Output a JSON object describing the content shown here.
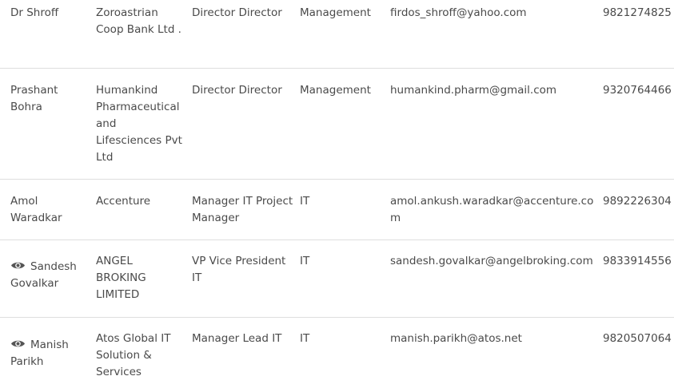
{
  "rows": [
    {
      "name": "Dr Shroff",
      "company": "Zoroastrian Coop Bank Ltd .",
      "title": "Director Director",
      "department": "Management",
      "email": "firdos_shroff@yahoo.com",
      "phone": "9821274825",
      "icon": ""
    },
    {
      "name": "Prashant Bohra",
      "company": "Humankind Pharmaceutical and Lifesciences Pvt Ltd",
      "title": "Director Director",
      "department": "Management",
      "email": "humankind.pharm@gmail.com",
      "phone": "9320764466",
      "icon": ""
    },
    {
      "name": "Amol Waradkar",
      "company": "Accenture",
      "title": "Manager IT Project Manager",
      "department": "IT",
      "email": "amol.ankush.waradkar@accenture.com",
      "phone": "9892226304",
      "icon": ""
    },
    {
      "name": "Sandesh Govalkar",
      "company": "ANGEL BROKING LIMITED",
      "title": "VP Vice President IT",
      "department": "IT",
      "email": "sandesh.govalkar@angelbroking.com",
      "phone": "9833914556",
      "icon": "eye-icon"
    },
    {
      "name": "Manish Parikh",
      "company": "Atos Global IT Solution & Services",
      "title": "Manager Lead IT",
      "department": "IT",
      "email": "manish.parikh@atos.net",
      "phone": "9820507064",
      "icon": "eye-icon"
    }
  ]
}
